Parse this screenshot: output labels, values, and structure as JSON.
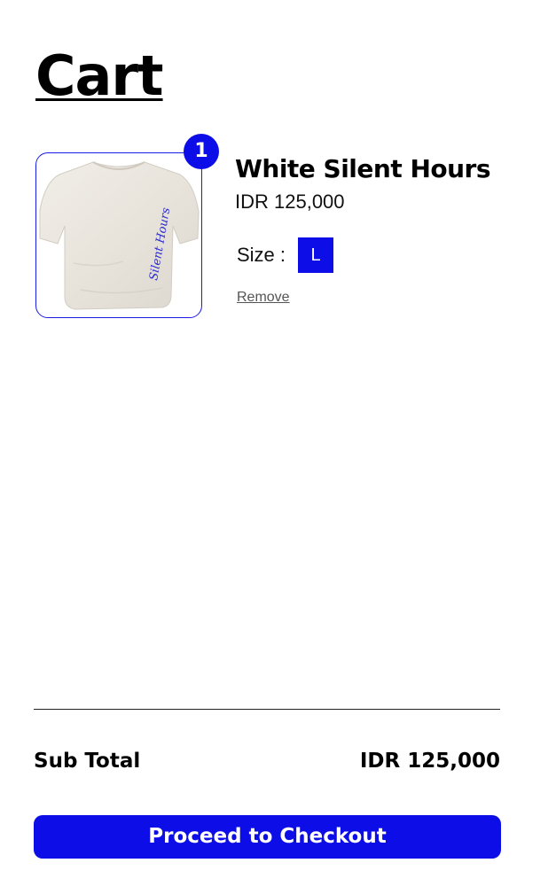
{
  "page": {
    "title": "Cart"
  },
  "cart": {
    "items": [
      {
        "quantity": "1",
        "name": "White Silent Hours",
        "price": "IDR 125,000",
        "size_label": "Size :",
        "size": "L",
        "remove_label": "Remove",
        "image": {
          "icon": "tshirt-image",
          "print_text": "Silent Hours"
        }
      }
    ]
  },
  "summary": {
    "subtotal_label": "Sub Total",
    "subtotal_value": "IDR 125,000"
  },
  "checkout": {
    "button_label": "Proceed to Checkout"
  },
  "colors": {
    "accent": "#0d0de8",
    "text": "#000000",
    "muted": "#555555",
    "background": "#ffffff",
    "tshirt": "#ebe7e0"
  }
}
